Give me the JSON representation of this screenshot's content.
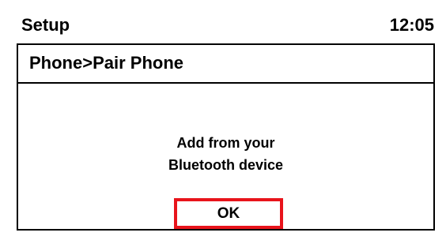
{
  "status_bar": {
    "title": "Setup",
    "time": "12:05"
  },
  "panel": {
    "breadcrumb": "Phone>Pair Phone",
    "message_line1": "Add from your",
    "message_line2": "Bluetooth device",
    "ok_label": "OK"
  },
  "colors": {
    "highlight": "#e8141b",
    "text": "#000000",
    "background": "#ffffff"
  }
}
